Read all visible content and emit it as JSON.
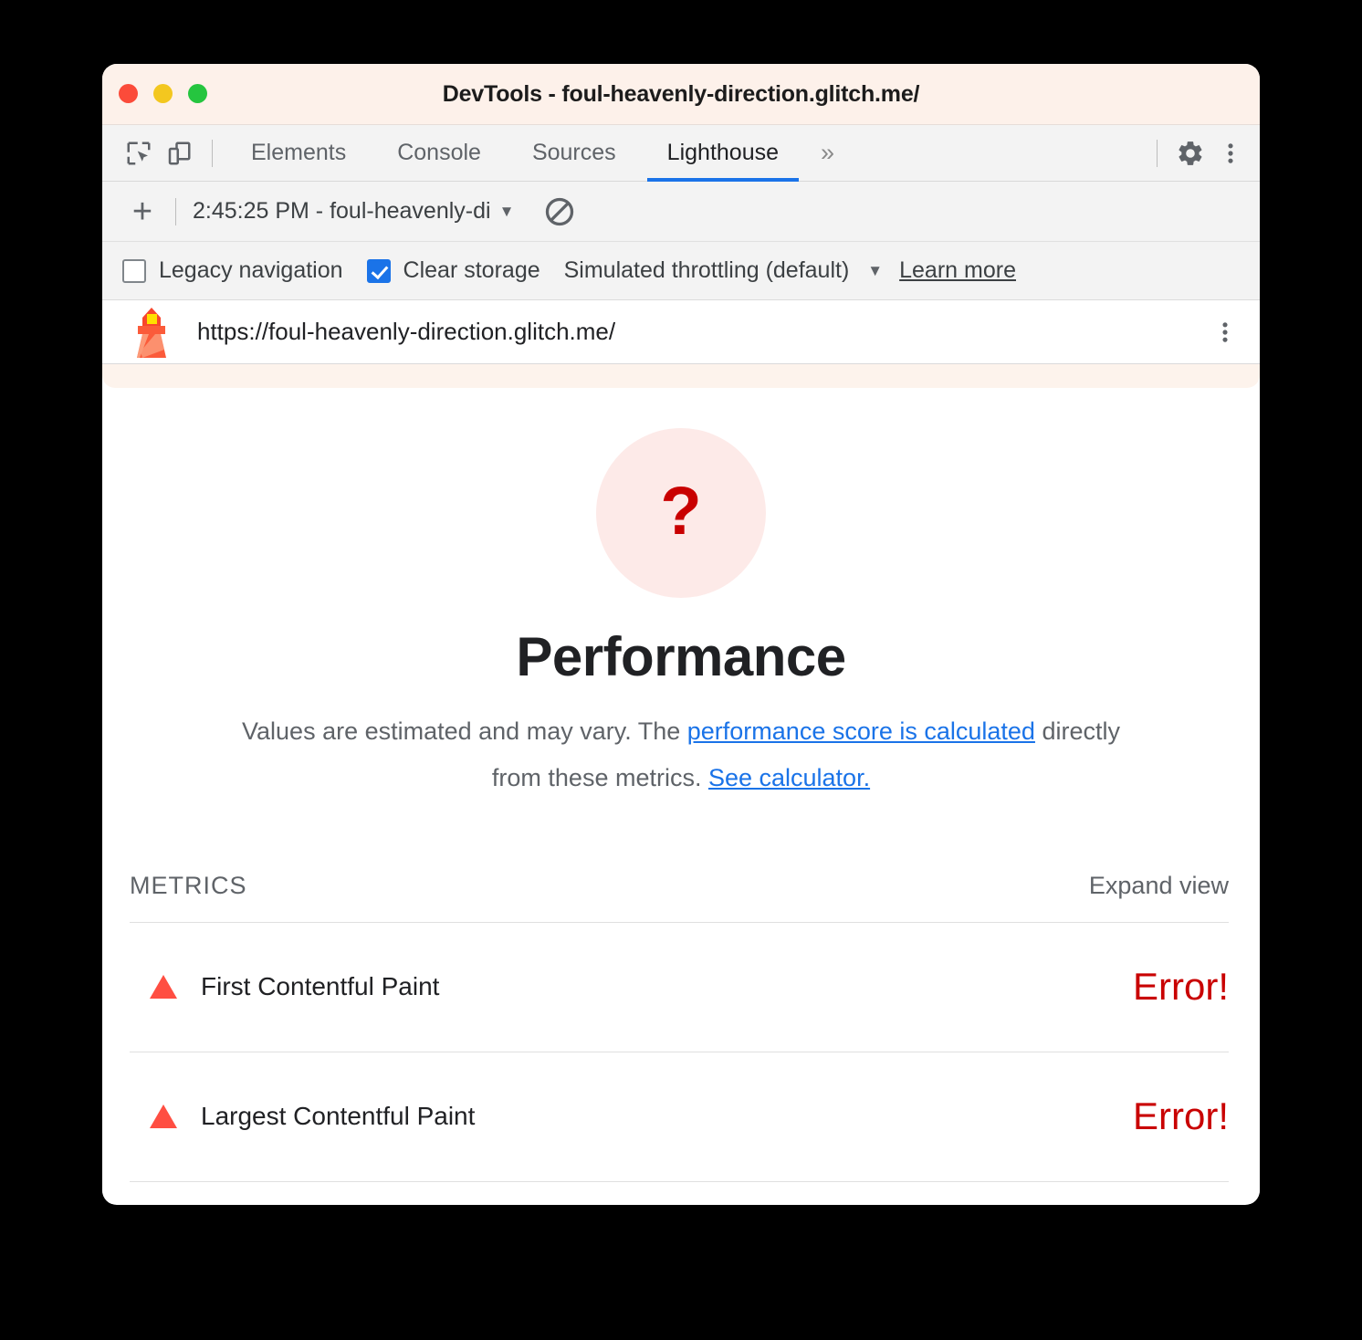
{
  "window": {
    "title": "DevTools - foul-heavenly-direction.glitch.me/",
    "traffic_lights": [
      "close",
      "minimize",
      "maximize"
    ]
  },
  "devtools": {
    "left_icons": [
      {
        "name": "inspect-element-icon",
        "label": "Inspect element"
      },
      {
        "name": "device-toolbar-icon",
        "label": "Toggle device toolbar"
      }
    ],
    "tabs": [
      {
        "label": "Elements",
        "active": false
      },
      {
        "label": "Console",
        "active": false
      },
      {
        "label": "Sources",
        "active": false
      },
      {
        "label": "Lighthouse",
        "active": true
      }
    ],
    "more_tabs_glyph": "»",
    "right_icons": [
      {
        "name": "settings-gear-icon",
        "label": "Settings"
      },
      {
        "name": "main-menu-kebab-icon",
        "label": "Customize and control DevTools"
      }
    ]
  },
  "lighthouse_toolbar": {
    "new_report_glyph": "+",
    "run_select_value": "2:45:25 PM - foul-heavenly-di",
    "caret_glyph": "▼",
    "clear_button_label": "Clear all"
  },
  "lighthouse_options": {
    "legacy_navigation": {
      "label": "Legacy navigation",
      "checked": false
    },
    "clear_storage": {
      "label": "Clear storage",
      "checked": true
    },
    "throttling": {
      "value": "Simulated throttling (default)",
      "caret_glyph": "▼"
    },
    "learn_more": "Learn more"
  },
  "report_header": {
    "url": "https://foul-heavenly-direction.glitch.me/",
    "logo_name": "lighthouse-logo-icon",
    "menu_label": "Report options"
  },
  "report": {
    "score_symbol": "?",
    "category_title": "Performance",
    "description": {
      "prefix": "Values are estimated and may vary. The ",
      "link1": "performance score is calculated",
      "middle": " directly from these metrics. ",
      "link2": "See calculator."
    },
    "metrics_label": "METRICS",
    "expand_view_label": "Expand view",
    "metrics": [
      {
        "name": "First Contentful Paint",
        "value": "Error!",
        "status": "error"
      },
      {
        "name": "Largest Contentful Paint",
        "value": "Error!",
        "status": "error"
      }
    ]
  },
  "colors": {
    "accent_blue": "#1a73e8",
    "error_red": "#c90000",
    "metric_triangle": "#ff4e42",
    "gauge_bg": "#fdeae8",
    "titlebar_bg": "#fdf1ea"
  }
}
